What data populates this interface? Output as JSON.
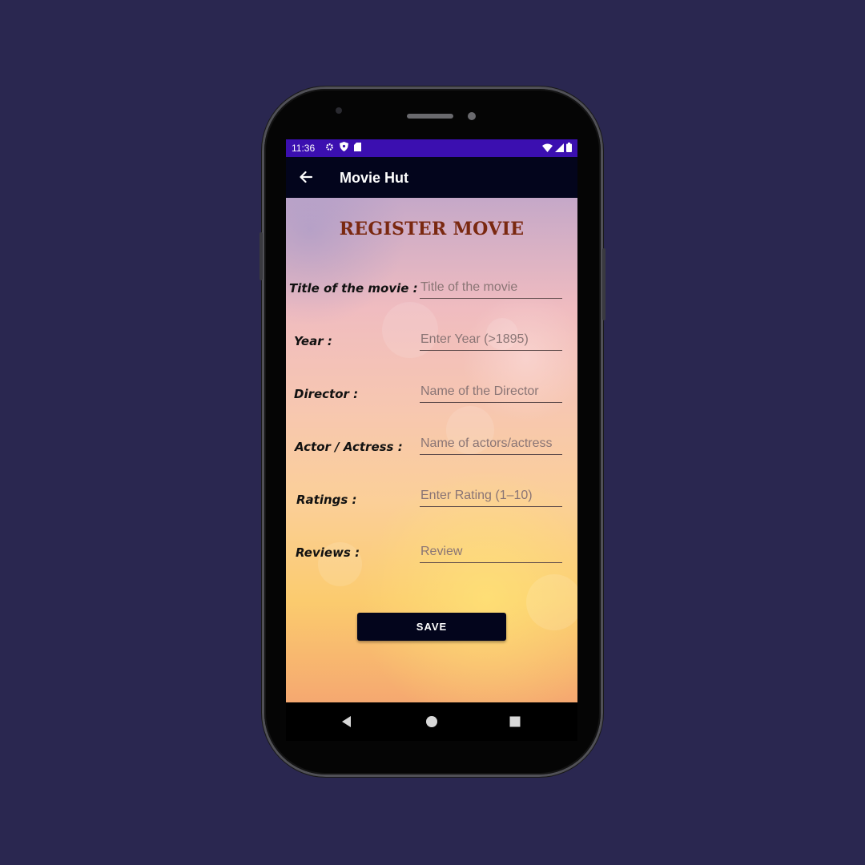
{
  "status_bar": {
    "time": "11:36",
    "background_color": "#3b0fb0",
    "left_icons": [
      "gear-icon",
      "shield-icon",
      "sim-card-icon"
    ],
    "right_icons": [
      "wifi-icon",
      "signal-icon",
      "battery-icon"
    ]
  },
  "app_bar": {
    "title": "Movie Hut",
    "background_color": "#03051c",
    "back_icon": "arrow-left-icon"
  },
  "form": {
    "title": "REGISTER MOVIE",
    "title_color": "#7a2810",
    "fields": [
      {
        "label": "Title of the movie :",
        "value": "",
        "placeholder": "Title of the movie"
      },
      {
        "label": "Year :",
        "value": "",
        "placeholder": "Enter Year (>1895)"
      },
      {
        "label": "Director :",
        "value": "",
        "placeholder": "Name of the Director"
      },
      {
        "label": "Actor / Actress :",
        "value": "",
        "placeholder": "Name of actors/actress"
      },
      {
        "label": "Ratings :",
        "value": "",
        "placeholder": "Enter Rating (1–10)"
      },
      {
        "label": "Reviews :",
        "value": "",
        "placeholder": "Review"
      }
    ],
    "save_label": "SAVE"
  },
  "nav_bar": {
    "items": [
      "back-triangle-icon",
      "home-circle-icon",
      "recents-square-icon"
    ]
  },
  "page_background": "#2a2750"
}
